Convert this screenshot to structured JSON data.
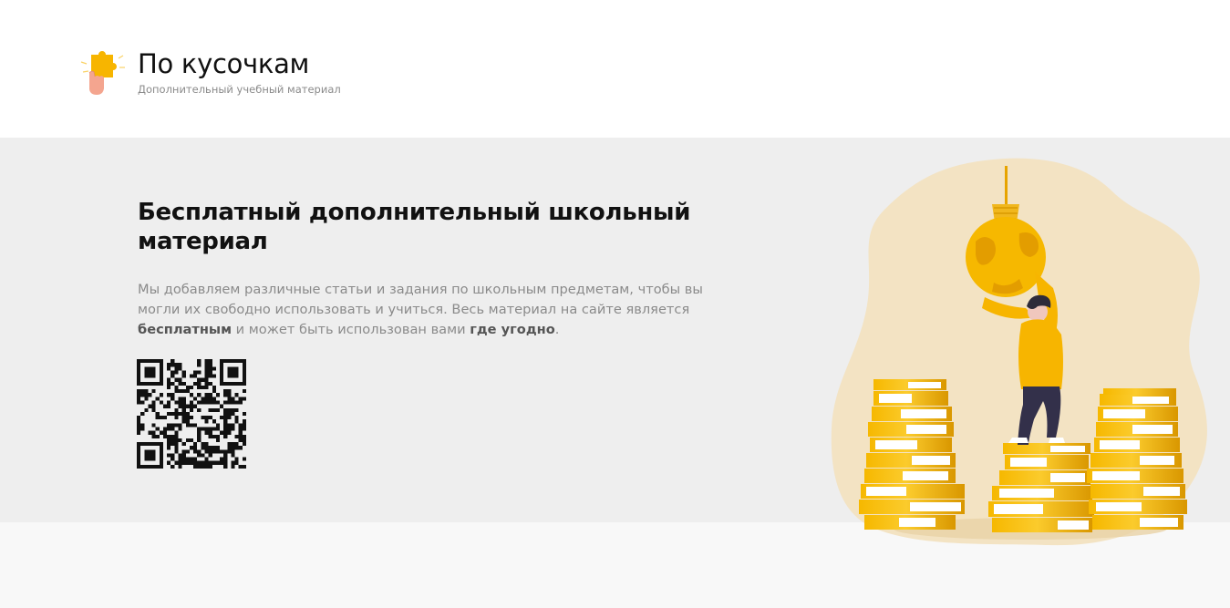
{
  "brand": {
    "title": "По кусочкам",
    "subtitle": "Дополнительный учебный материал",
    "logo_icon": "puzzle-piece-hand-icon"
  },
  "hero": {
    "title": "Бесплатный дополнительный школьный материал",
    "text_1": "Мы добавляем различные статьи и задания по школьным предметам, чтобы вы могли их свободно использовать и учиться. Весь материал на сайте является ",
    "text_bold_1": "бесплатным",
    "text_2": " и может быть использован вами ",
    "text_bold_2": "где угодно",
    "text_3": ".",
    "qr_icon": "qr-code-icon",
    "illustration": "person-holding-lightbulb-on-coin-stacks-illustration"
  },
  "colors": {
    "accent": "#f7b500",
    "hero_background": "#eeeeee",
    "blob": "#f3e3c3",
    "text_muted": "#8a8a8a"
  }
}
